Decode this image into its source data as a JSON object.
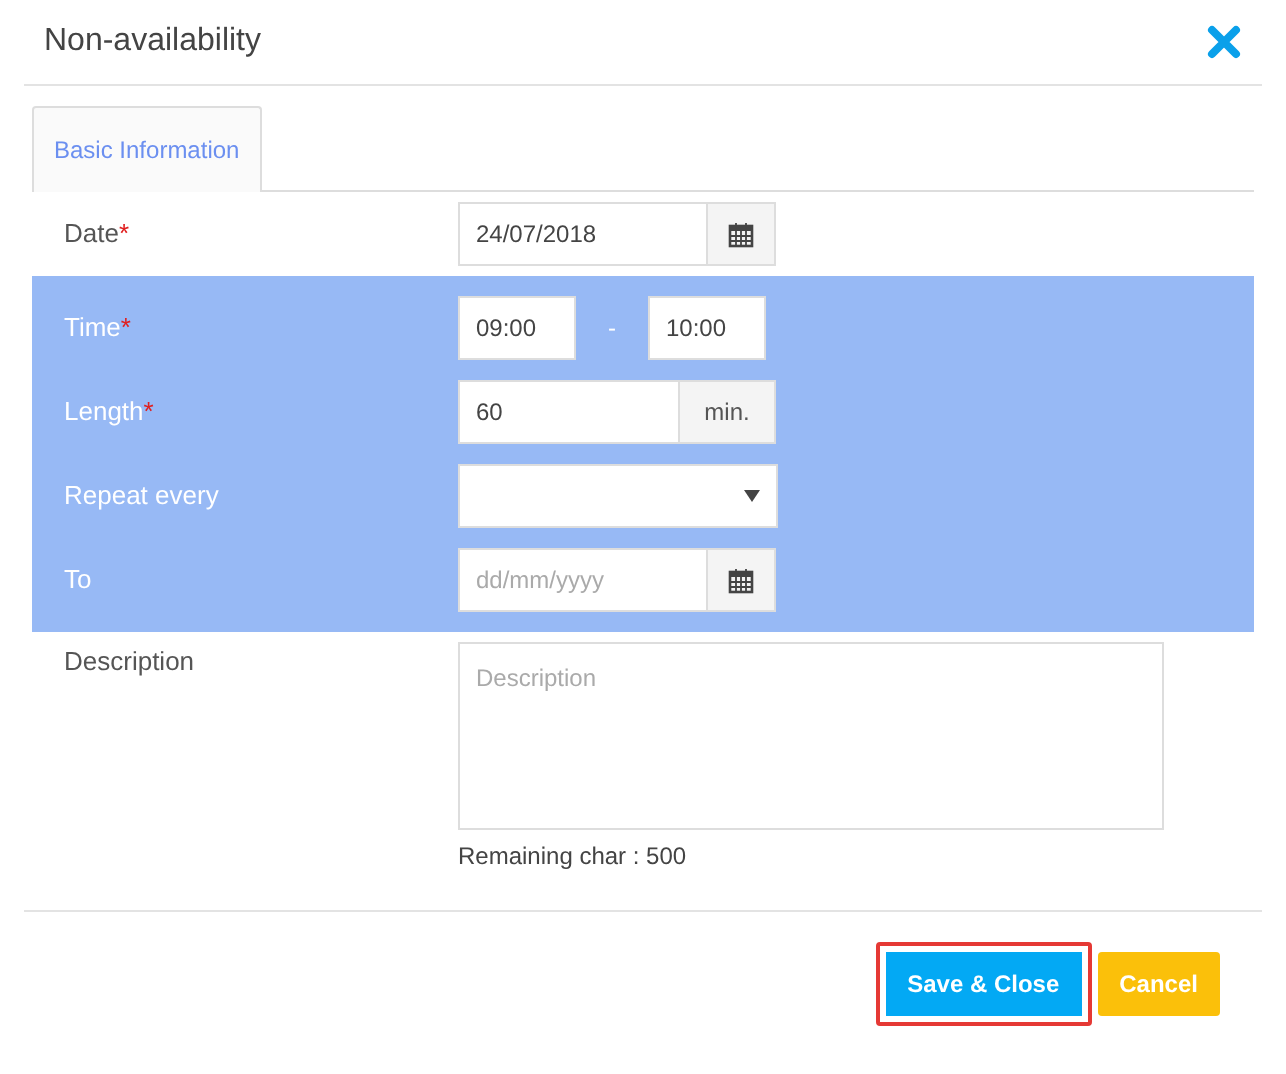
{
  "dialog": {
    "title": "Non-availability"
  },
  "tabs": [
    {
      "label": "Basic Information",
      "selected": true
    }
  ],
  "fields": [
    {
      "kind": "date",
      "label": "Date",
      "required_mark": "*",
      "highlighted": false,
      "value": "24/07/2018"
    },
    {
      "kind": "time_range",
      "label": "Time",
      "required_mark": "*",
      "highlighted": true,
      "from": "09:00",
      "separator": "-",
      "to": "10:00"
    },
    {
      "kind": "addon",
      "label": "Length",
      "required_mark": "*",
      "highlighted": true,
      "value": "60",
      "addon": "min."
    },
    {
      "kind": "select",
      "label": "Repeat every",
      "highlighted": true
    },
    {
      "kind": "date",
      "label": "To",
      "highlighted": true,
      "placeholder": "dd/mm/yyyy"
    },
    {
      "kind": "textarea",
      "label": "Description",
      "highlighted": false,
      "placeholder": "Description",
      "hint": "Remaining char : 500"
    }
  ],
  "buttons": [
    {
      "label": "Save & Close",
      "kind": "primary",
      "outlined": true
    },
    {
      "label": "Cancel",
      "kind": "warning",
      "outlined": false
    }
  ]
}
